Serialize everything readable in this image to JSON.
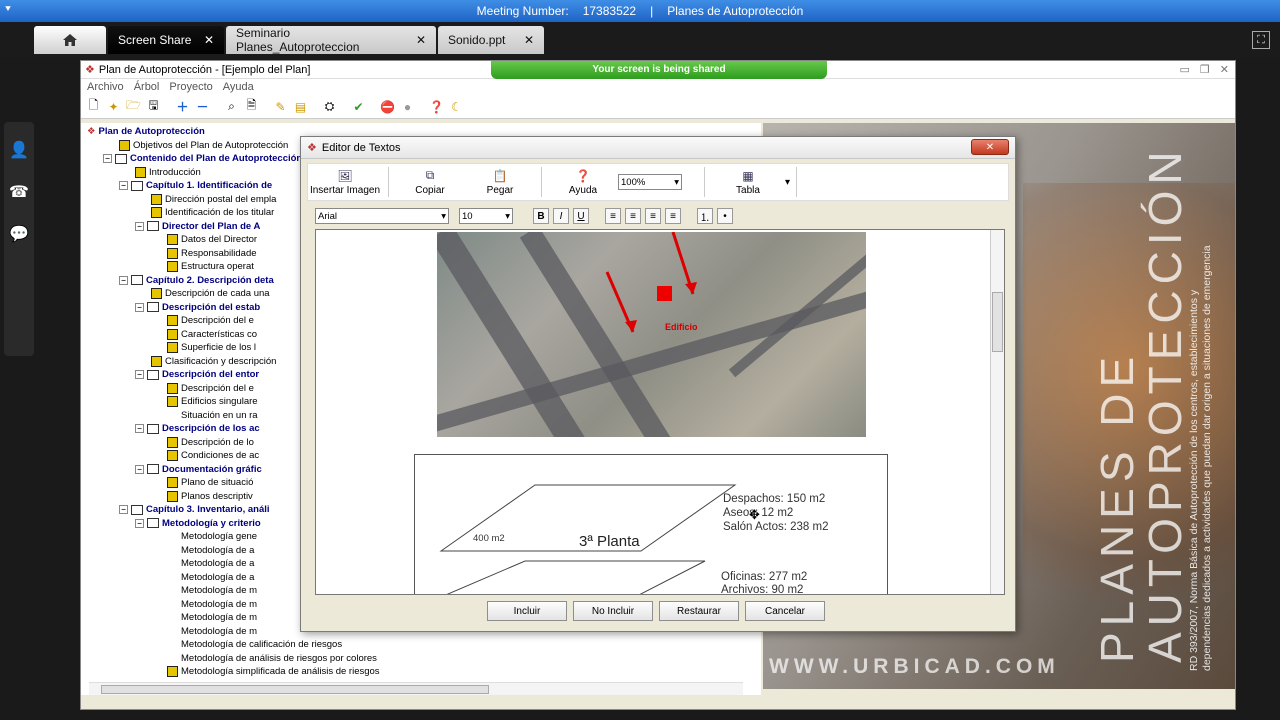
{
  "meeting": {
    "label": "Meeting Number:",
    "number": "17383522",
    "separator": "|",
    "topic": "Planes de Autoprotección"
  },
  "tabs": [
    {
      "label": "Screen Share",
      "close": "✕"
    },
    {
      "label": "Seminario Planes_Autoproteccion",
      "close": "✕"
    },
    {
      "label": "Sonido.ppt",
      "close": "✕"
    }
  ],
  "app": {
    "title": "Plan de Autoprotección - [Ejemplo del Plan]",
    "sharing_banner": "Your screen is being shared",
    "menu": [
      "Archivo",
      "Árbol",
      "Proyecto",
      "Ayuda"
    ]
  },
  "tree": [
    {
      "text": "Plan de Autoprotección",
      "indent": 0,
      "bold": true,
      "icon": "root"
    },
    {
      "text": "Objetivos del Plan de Autoprotección",
      "indent": 2,
      "bold": false,
      "icon": "diamond"
    },
    {
      "text": "Contenido del Plan de Autoprotección",
      "indent": 1,
      "bold": true,
      "icon": "book",
      "exp": "−"
    },
    {
      "text": "Introducción",
      "indent": 3,
      "bold": false,
      "icon": "diamond"
    },
    {
      "text": "Capítulo 1. Identificación de",
      "indent": 2,
      "bold": true,
      "icon": "book",
      "exp": "−"
    },
    {
      "text": "Dirección postal del empla",
      "indent": 4,
      "bold": false,
      "icon": "diamond"
    },
    {
      "text": "Identificación de los titular",
      "indent": 4,
      "bold": false,
      "icon": "diamond"
    },
    {
      "text": "Director del Plan de A",
      "indent": 3,
      "bold": true,
      "icon": "book",
      "exp": "−"
    },
    {
      "text": "Datos del Director",
      "indent": 5,
      "bold": false,
      "icon": "diamond"
    },
    {
      "text": "Responsabilidade",
      "indent": 5,
      "bold": false,
      "icon": "diamond"
    },
    {
      "text": "Estructura operat",
      "indent": 5,
      "bold": false,
      "icon": "diamond"
    },
    {
      "text": "Capítulo 2. Descripción deta",
      "indent": 2,
      "bold": true,
      "icon": "book",
      "exp": "−"
    },
    {
      "text": "Descripción de cada una",
      "indent": 4,
      "bold": false,
      "icon": "diamond"
    },
    {
      "text": "Descripción del estab",
      "indent": 3,
      "bold": true,
      "icon": "book",
      "exp": "−"
    },
    {
      "text": "Descripción del e",
      "indent": 5,
      "bold": false,
      "icon": "diamond"
    },
    {
      "text": "Características co",
      "indent": 5,
      "bold": false,
      "icon": "diamond"
    },
    {
      "text": "Superficie de los l",
      "indent": 5,
      "bold": false,
      "icon": "diamond"
    },
    {
      "text": "Clasificación y descripción",
      "indent": 4,
      "bold": false,
      "icon": "diamond"
    },
    {
      "text": "Descripción del entor",
      "indent": 3,
      "bold": true,
      "icon": "book",
      "exp": "−"
    },
    {
      "text": "Descripción del e",
      "indent": 5,
      "bold": false,
      "icon": "diamond"
    },
    {
      "text": "Edificios singulare",
      "indent": 5,
      "bold": false,
      "icon": "diamond"
    },
    {
      "text": "Situación en un ra",
      "indent": 5,
      "bold": false,
      "icon": "none"
    },
    {
      "text": "Descripción de los ac",
      "indent": 3,
      "bold": true,
      "icon": "book",
      "exp": "−"
    },
    {
      "text": "Descripción de lo",
      "indent": 5,
      "bold": false,
      "icon": "diamond"
    },
    {
      "text": "Condiciones de ac",
      "indent": 5,
      "bold": false,
      "icon": "diamond"
    },
    {
      "text": "Documentación gráfic",
      "indent": 3,
      "bold": true,
      "icon": "book",
      "exp": "−"
    },
    {
      "text": "Plano de situació",
      "indent": 5,
      "bold": false,
      "icon": "diamond"
    },
    {
      "text": "Planos descriptiv",
      "indent": 5,
      "bold": false,
      "icon": "diamond"
    },
    {
      "text": "Capítulo 3. Inventario, análi",
      "indent": 2,
      "bold": true,
      "icon": "book",
      "exp": "−"
    },
    {
      "text": "Metodología y criterio",
      "indent": 3,
      "bold": true,
      "icon": "book",
      "exp": "−"
    },
    {
      "text": "Metodología gene",
      "indent": 5,
      "bold": false,
      "icon": "none"
    },
    {
      "text": "Metodología de a",
      "indent": 5,
      "bold": false,
      "icon": "none"
    },
    {
      "text": "Metodología de a",
      "indent": 5,
      "bold": false,
      "icon": "none"
    },
    {
      "text": "Metodología de a",
      "indent": 5,
      "bold": false,
      "icon": "none"
    },
    {
      "text": "Metodología de m",
      "indent": 5,
      "bold": false,
      "icon": "none"
    },
    {
      "text": "Metodología de m",
      "indent": 5,
      "bold": false,
      "icon": "none"
    },
    {
      "text": "Metodología de m",
      "indent": 5,
      "bold": false,
      "icon": "none"
    },
    {
      "text": "Metodología de m",
      "indent": 5,
      "bold": false,
      "icon": "none"
    },
    {
      "text": "Metodología de calificación de riesgos",
      "indent": 5,
      "bold": false,
      "icon": "none"
    },
    {
      "text": "Metodología de análisis de riesgos por colores",
      "indent": 5,
      "bold": false,
      "icon": "none"
    },
    {
      "text": "Metodología simplificada de análisis de riesgos",
      "indent": 5,
      "bold": false,
      "icon": "diamond"
    }
  ],
  "poster": {
    "title_line1": "PLANES DE",
    "title_line2": "AUTOPROTECCIÓN",
    "subtitle_line1": "RD 393/2007, Norma Básica de Autoprotección de los centros, establecimientos y",
    "subtitle_line2": "dependencias dedicados a actividades que puedan dar origen a situaciones de emergencia",
    "url": "WWW.URBICAD.COM"
  },
  "editor": {
    "title": "Editor de Textos",
    "close_label": "✕",
    "tools": [
      "Insertar Imagen",
      "Copiar",
      "Pegar",
      "Ayuda"
    ],
    "zoom": "100%",
    "table_label": "Tabla",
    "font": "Arial",
    "size": "10",
    "map_label": "Edificio",
    "plan": {
      "floor": "3ª Planta",
      "area": "400 m2",
      "despachos": "Despachos: 150 m2",
      "aseos": "Aseos: 12 m2",
      "salon": "Salón Actos: 238 m2",
      "oficinas": "Oficinas: 277 m2",
      "archivos": "Archivos: 90 m2"
    },
    "buttons": [
      "Incluir",
      "No Incluir",
      "Restaurar",
      "Cancelar"
    ]
  }
}
